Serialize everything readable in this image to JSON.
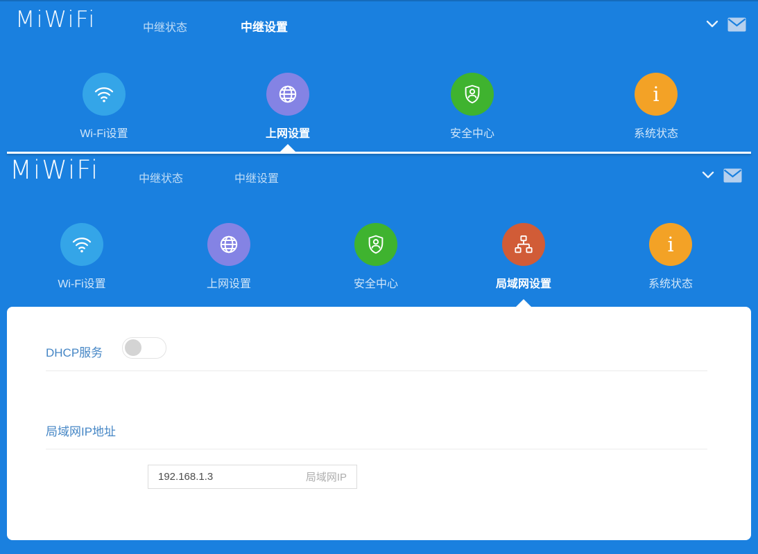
{
  "brand": "MiWiFi",
  "colors": {
    "header_blue": "#1a80df",
    "wifi_blue": "#34a5e8",
    "internet_purple": "#8483e4",
    "security_green": "#3fb32f",
    "lan_orange": "#d15c37",
    "system_amber": "#f3a226"
  },
  "section_top": {
    "logo": "MiWiFi",
    "tabs": [
      {
        "label": "中继状态"
      },
      {
        "label": "中继设置"
      }
    ],
    "icons": [
      {
        "label": "Wi-Fi设置",
        "color": "#34a5e8"
      },
      {
        "label": "上网设置",
        "color": "#8483e4"
      },
      {
        "label": "安全中心",
        "color": "#3fb32f"
      },
      {
        "label": "系统状态",
        "color": "#f3a226"
      }
    ]
  },
  "section_main": {
    "logo": "MiWiFi",
    "tabs": [
      {
        "label": "中继状态"
      },
      {
        "label": "中继设置"
      }
    ],
    "icons": [
      {
        "label": "Wi-Fi设置",
        "color": "#34a5e8"
      },
      {
        "label": "上网设置",
        "color": "#8483e4"
      },
      {
        "label": "安全中心",
        "color": "#3fb32f"
      },
      {
        "label": "局域网设置",
        "color": "#d15c37"
      },
      {
        "label": "系统状态",
        "color": "#f3a226"
      }
    ]
  },
  "panel": {
    "dhcp": {
      "label": "DHCP服务",
      "state": "off"
    },
    "lan_ip": {
      "heading": "局域网IP地址",
      "value": "192.168.1.3",
      "hint": "局域网IP"
    }
  }
}
